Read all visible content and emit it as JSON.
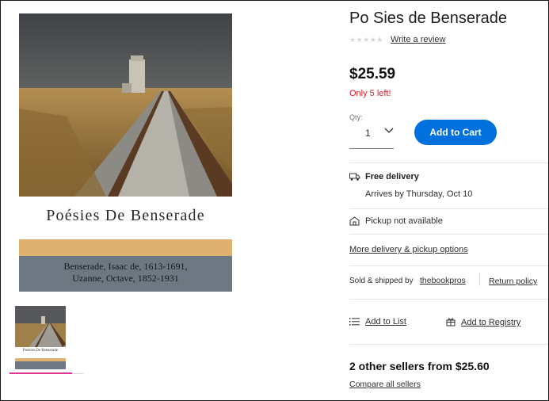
{
  "product": {
    "title": "Po Sies de Benserade",
    "stars": "★★★★★",
    "review_link": "Write a review",
    "price": "$25.59",
    "stock_warning": "Only 5 left!",
    "qty_label": "Qty:",
    "qty_value": "1",
    "add_to_cart": "Add to Cart"
  },
  "cover": {
    "title": "Poésies De Benserade",
    "author_line_1": "Benserade, Isaac de, 1613-1691,",
    "author_line_2": "Uzanne, Octave, 1852-1931"
  },
  "fulfillment": {
    "delivery_title": "Free delivery",
    "delivery_date": "Arrives by Thursday, Oct 10",
    "pickup": "Pickup not available",
    "more_options": "More delivery & pickup options"
  },
  "seller": {
    "sold_by_label": "Sold & shipped by",
    "seller_name": "thebookpros",
    "return_policy": "Return policy"
  },
  "actions": {
    "add_to_list": "Add to List",
    "add_to_registry": "Add to Registry"
  },
  "other_sellers": {
    "headline": "2 other sellers from $25.60",
    "compare_link": "Compare all sellers"
  },
  "colors": {
    "accent": "#0071dc",
    "stock_warning": "#de1c24",
    "thumbnail_selected": "#e0358f"
  }
}
